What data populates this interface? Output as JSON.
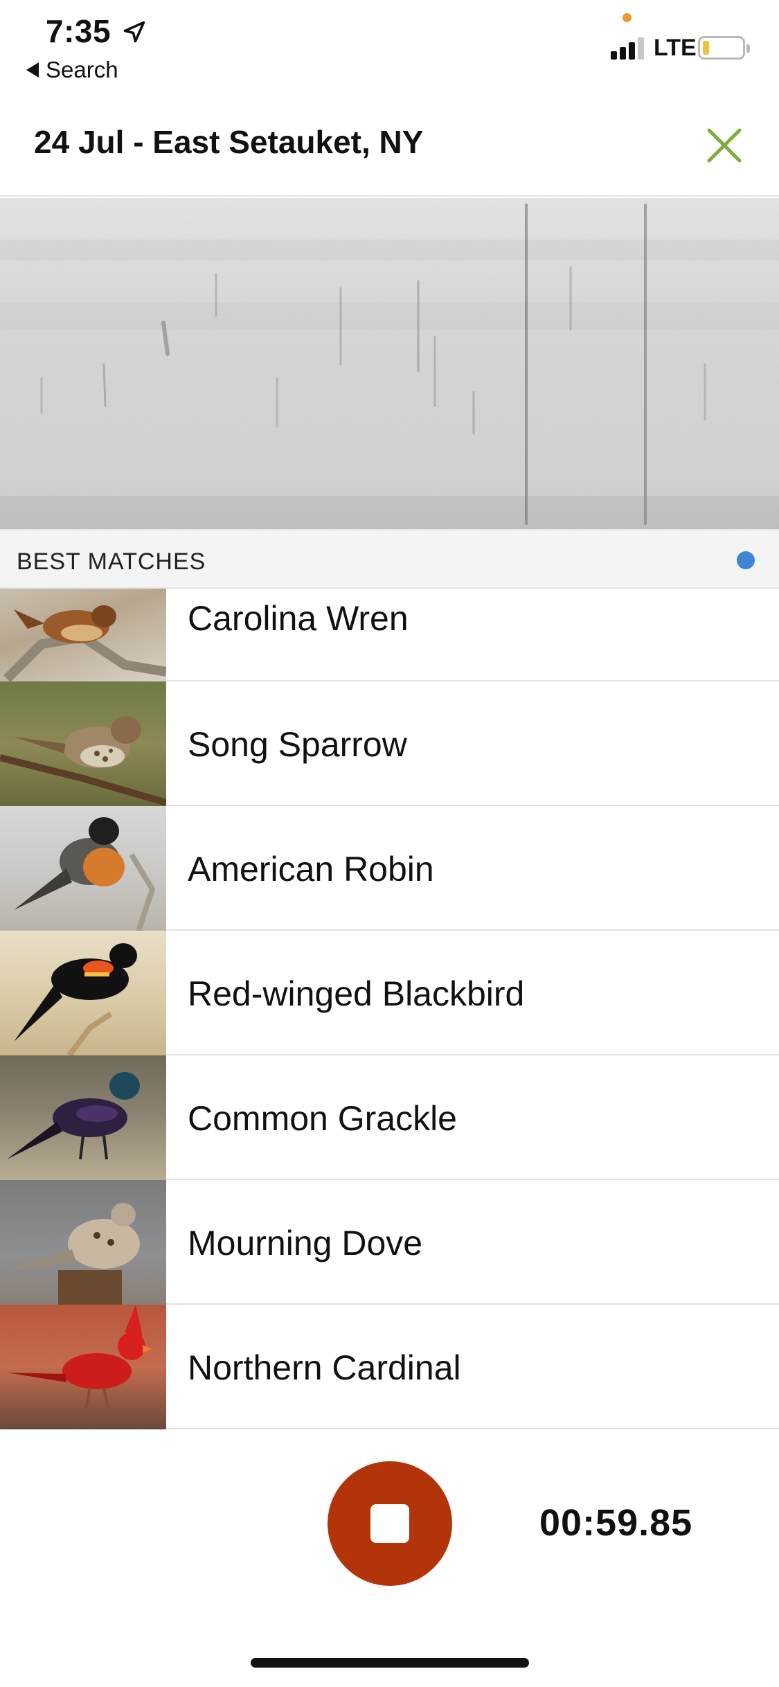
{
  "status_bar": {
    "time": "7:35",
    "back_label": "Search",
    "network": "LTE",
    "icons": [
      "location-arrow-icon",
      "signal-icon",
      "battery-icon"
    ]
  },
  "header": {
    "title": "24 Jul - East Setauket, NY",
    "close_icon": "close-icon",
    "accent_color": "#7cae3c"
  },
  "section": {
    "title": "BEST MATCHES",
    "indicator_color": "#3d86d6"
  },
  "matches": [
    {
      "name": "Carolina Wren"
    },
    {
      "name": "Song Sparrow"
    },
    {
      "name": "American Robin"
    },
    {
      "name": "Red-winged Blackbird"
    },
    {
      "name": "Common Grackle"
    },
    {
      "name": "Mourning Dove"
    },
    {
      "name": "Northern Cardinal"
    }
  ],
  "recording": {
    "timer": "00:59.85",
    "stop_icon": "stop-icon",
    "stop_color": "#b33408"
  }
}
